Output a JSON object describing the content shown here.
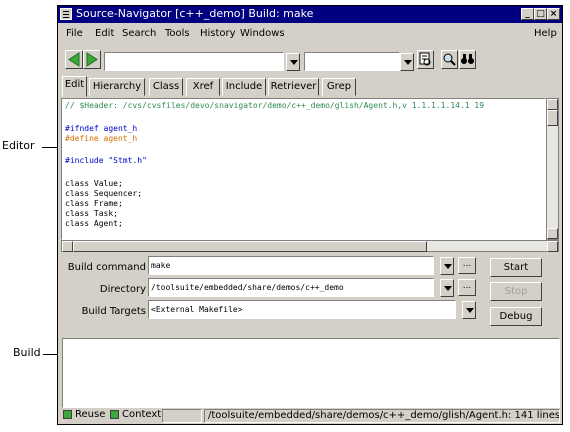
{
  "callouts": {
    "editor": "Editor",
    "build": "Build"
  },
  "window": {
    "title": "Source-Navigator [c++_demo] Build: make"
  },
  "menu": {
    "file": "File",
    "edit": "Edit",
    "search": "Search",
    "tools": "Tools",
    "history": "History",
    "windows": "Windows",
    "help": "Help"
  },
  "toolbar": {
    "combo1_value": "",
    "combo2_value": ""
  },
  "tabs": [
    "Edit",
    "Hierarchy",
    "Class",
    "Xref",
    "Include",
    "Retriever",
    "Grep"
  ],
  "editor": {
    "lines": [
      "// $Header: /cvs/cvsfiles/devo/snavigator/demo/c++_demo/glish/Agent.h,v 1.1.1.1.14.1 19",
      "",
      "#ifndef agent_h",
      "#define agent_h",
      "",
      "#include \"Stmt.h\"",
      "",
      "class Value;",
      "class Sequencer;",
      "class Frame;",
      "class Task;",
      "class Agent;"
    ]
  },
  "build": {
    "command_label": "Build command",
    "command_value": "make",
    "directory_label": "Directory",
    "directory_value": "/toolsuite/embedded/share/demos/c++_demo",
    "targets_label": "Build Targets",
    "targets_value": "<External Makefile>",
    "browse_label": "...",
    "start_label": "Start",
    "stop_label": "Stop",
    "debug_label": "Debug"
  },
  "status": {
    "reuse_label": "Reuse",
    "context_label": "Context",
    "file_info": "/toolsuite/embedded/share/demos/c++_demo/glish/Agent.h: 141 lines"
  },
  "colors": {
    "titlebar": "#000080",
    "comment": "#2e8b57",
    "preprocessor": "#0000cc",
    "macro_name": "#d07000",
    "keyword": "#0000cc"
  }
}
